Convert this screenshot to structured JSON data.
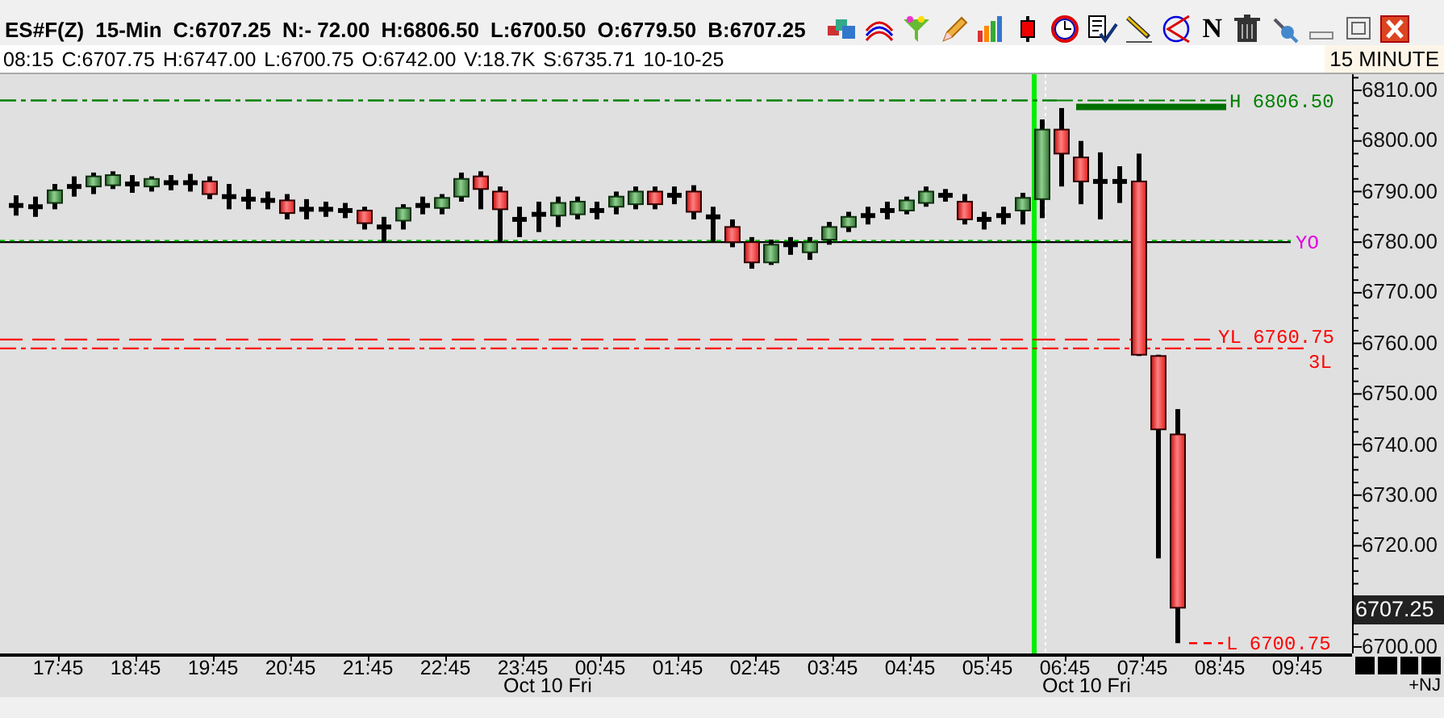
{
  "header": {
    "quote": [
      "ES#F(Z)",
      "15-Min",
      "C:6707.25",
      "N:- 72.00",
      "H:6806.50",
      "L:6700.50",
      "O:6779.50",
      "B:6707.25"
    ],
    "bar_info": [
      "08:15",
      "C:6707.75",
      "H:6747.00",
      "L:6700.75",
      "O:6742.00",
      "V:18.7K",
      "S:6735.71",
      "10-10-25"
    ],
    "interval": "15 MINUTE",
    "text_tool": "N"
  },
  "chart": {
    "levels": [
      {
        "kind": "high",
        "label": "H 6806.50"
      },
      {
        "kind": "yopen",
        "label": "YO"
      },
      {
        "kind": "ylow",
        "label": "YL 6760.75"
      },
      {
        "kind": "third",
        "label": "3L"
      },
      {
        "kind": "low",
        "label": "L 6700.75"
      }
    ]
  },
  "price_axis": {
    "labels": [
      "6810.00",
      "6800.00",
      "6790.00",
      "6780.00",
      "6770.00",
      "6760.00",
      "6750.00",
      "6740.00",
      "6730.00",
      "6720.00",
      "6700.00"
    ],
    "current_price": "6707.25"
  },
  "time_axis": {
    "labels": [
      "17:45",
      "18:45",
      "19:45",
      "20:45",
      "21:45",
      "22:45",
      "23:45",
      "00:45",
      "01:45",
      "02:45",
      "03:45",
      "04:45",
      "05:45",
      "06:45",
      "07:45",
      "08:45",
      "09:45"
    ],
    "dates": [
      "Oct 10 Fri",
      "Oct 10 Fri"
    ],
    "corner": "+NJ"
  }
}
